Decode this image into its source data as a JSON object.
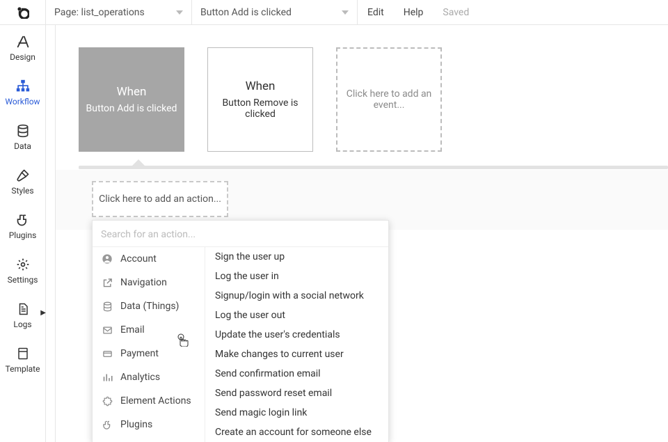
{
  "topbar": {
    "page_label_prefix": "Page:",
    "page_name": "list_operations",
    "event_name": "Button Add is clicked",
    "edit": "Edit",
    "help": "Help",
    "saved": "Saved"
  },
  "sidebar": {
    "items": [
      {
        "label": "Design",
        "icon": "design-icon"
      },
      {
        "label": "Workflow",
        "icon": "workflow-icon"
      },
      {
        "label": "Data",
        "icon": "data-icon"
      },
      {
        "label": "Styles",
        "icon": "styles-icon"
      },
      {
        "label": "Plugins",
        "icon": "plugins-icon"
      },
      {
        "label": "Settings",
        "icon": "settings-icon"
      },
      {
        "label": "Logs",
        "icon": "logs-icon"
      },
      {
        "label": "Template",
        "icon": "template-icon"
      }
    ],
    "active_index": 1
  },
  "events": [
    {
      "when": "When",
      "desc": "Button Add is clicked",
      "selected": true
    },
    {
      "when": "When",
      "desc": "Button Remove is clicked",
      "selected": false
    }
  ],
  "add_event_label": "Click here to add an event...",
  "add_action_label": "Click here to add an action...",
  "action_popup": {
    "search_placeholder": "Search for an action...",
    "categories": [
      {
        "label": "Account",
        "icon": "user-circle-icon"
      },
      {
        "label": "Navigation",
        "icon": "external-link-icon"
      },
      {
        "label": "Data (Things)",
        "icon": "database-icon"
      },
      {
        "label": "Email",
        "icon": "mail-icon"
      },
      {
        "label": "Payment",
        "icon": "card-icon"
      },
      {
        "label": "Analytics",
        "icon": "chart-icon"
      },
      {
        "label": "Element Actions",
        "icon": "puzzle-icon"
      },
      {
        "label": "Plugins",
        "icon": "plug-icon"
      }
    ],
    "actions": [
      "Sign the user up",
      "Log the user in",
      "Signup/login with a social network",
      "Log the user out",
      "Update the user's credentials",
      "Make changes to current user",
      "Send confirmation email",
      "Send password reset email",
      "Send magic login link",
      "Create an account for someone else"
    ]
  }
}
